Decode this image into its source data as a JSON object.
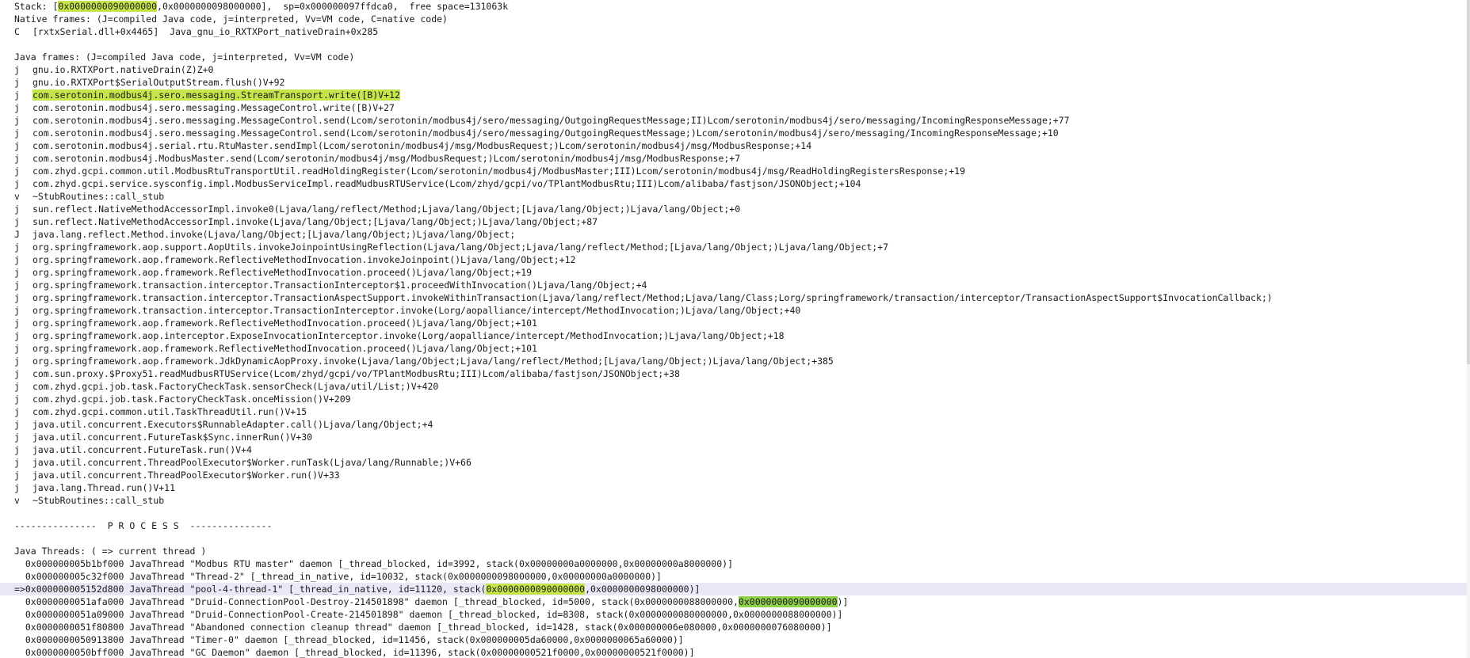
{
  "editor": {
    "stack_line": {
      "prefix": "Stack: [",
      "hl": "0x0000000090000000",
      "suffix": ",0x0000000098000000],  sp=0x000000097ffdca0,  free space=131063k"
    },
    "native_header": "Native frames: (J=compiled Java code, j=interpreted, Vv=VM code, C=native code)",
    "native_frame": {
      "type": "C",
      "text": "[rxtxSerial.dll+0x4465]  Java_gnu_io_RXTXPort_nativeDrain+0x285"
    },
    "java_header": "Java frames: (J=compiled Java code, j=interpreted, Vv=VM code)",
    "java_frames": [
      {
        "type": "j",
        "text": "gnu.io.RXTXPort.nativeDrain(Z)Z+0"
      },
      {
        "type": "j",
        "text": "gnu.io.RXTXPort$SerialOutputStream.flush()V+92"
      },
      {
        "type": "j",
        "text": "com.serotonin.modbus4j.sero.messaging.StreamTransport.write([B)V+12"
      },
      {
        "type": "j",
        "text": "com.serotonin.modbus4j.sero.messaging.MessageControl.write([B)V+27"
      },
      {
        "type": "j",
        "text": "com.serotonin.modbus4j.sero.messaging.MessageControl.send(Lcom/serotonin/modbus4j/sero/messaging/OutgoingRequestMessage;II)Lcom/serotonin/modbus4j/sero/messaging/IncomingResponseMessage;+77"
      },
      {
        "type": "j",
        "text": "com.serotonin.modbus4j.sero.messaging.MessageControl.send(Lcom/serotonin/modbus4j/sero/messaging/OutgoingRequestMessage;)Lcom/serotonin/modbus4j/sero/messaging/IncomingResponseMessage;+10"
      },
      {
        "type": "j",
        "text": "com.serotonin.modbus4j.serial.rtu.RtuMaster.sendImpl(Lcom/serotonin/modbus4j/msg/ModbusRequest;)Lcom/serotonin/modbus4j/msg/ModbusResponse;+14"
      },
      {
        "type": "j",
        "text": "com.serotonin.modbus4j.ModbusMaster.send(Lcom/serotonin/modbus4j/msg/ModbusRequest;)Lcom/serotonin/modbus4j/msg/ModbusResponse;+7"
      },
      {
        "type": "j",
        "text": "com.zhyd.gcpi.common.util.ModbusRtuTransportUtil.readHoldingRegister(Lcom/serotonin/modbus4j/ModbusMaster;III)Lcom/serotonin/modbus4j/msg/ReadHoldingRegistersResponse;+19"
      },
      {
        "type": "j",
        "text": "com.zhyd.gcpi.service.sysconfig.impl.ModbusServiceImpl.readMudbusRTUService(Lcom/zhyd/gcpi/vo/TPlantModbusRtu;III)Lcom/alibaba/fastjson/JSONObject;+104"
      },
      {
        "type": "v",
        "text": "~StubRoutines::call_stub"
      },
      {
        "type": "j",
        "text": "sun.reflect.NativeMethodAccessorImpl.invoke0(Ljava/lang/reflect/Method;Ljava/lang/Object;[Ljava/lang/Object;)Ljava/lang/Object;+0"
      },
      {
        "type": "j",
        "text": "sun.reflect.NativeMethodAccessorImpl.invoke(Ljava/lang/Object;[Ljava/lang/Object;)Ljava/lang/Object;+87"
      },
      {
        "type": "J",
        "text": "java.lang.reflect.Method.invoke(Ljava/lang/Object;[Ljava/lang/Object;)Ljava/lang/Object;"
      },
      {
        "type": "j",
        "text": "org.springframework.aop.support.AopUtils.invokeJoinpointUsingReflection(Ljava/lang/Object;Ljava/lang/reflect/Method;[Ljava/lang/Object;)Ljava/lang/Object;+7"
      },
      {
        "type": "j",
        "text": "org.springframework.aop.framework.ReflectiveMethodInvocation.invokeJoinpoint()Ljava/lang/Object;+12"
      },
      {
        "type": "j",
        "text": "org.springframework.aop.framework.ReflectiveMethodInvocation.proceed()Ljava/lang/Object;+19"
      },
      {
        "type": "j",
        "text": "org.springframework.transaction.interceptor.TransactionInterceptor$1.proceedWithInvocation()Ljava/lang/Object;+4"
      },
      {
        "type": "j",
        "text": "org.springframework.transaction.interceptor.TransactionAspectSupport.invokeWithinTransaction(Ljava/lang/reflect/Method;Ljava/lang/Class;Lorg/springframework/transaction/interceptor/TransactionAspectSupport$InvocationCallback;)"
      },
      {
        "type": "j",
        "text": "org.springframework.transaction.interceptor.TransactionInterceptor.invoke(Lorg/aopalliance/intercept/MethodInvocation;)Ljava/lang/Object;+40"
      },
      {
        "type": "j",
        "text": "org.springframework.aop.framework.ReflectiveMethodInvocation.proceed()Ljava/lang/Object;+101"
      },
      {
        "type": "j",
        "text": "org.springframework.aop.interceptor.ExposeInvocationInterceptor.invoke(Lorg/aopalliance/intercept/MethodInvocation;)Ljava/lang/Object;+18"
      },
      {
        "type": "j",
        "text": "org.springframework.aop.framework.ReflectiveMethodInvocation.proceed()Ljava/lang/Object;+101"
      },
      {
        "type": "j",
        "text": "org.springframework.aop.framework.JdkDynamicAopProxy.invoke(Ljava/lang/Object;Ljava/lang/reflect/Method;[Ljava/lang/Object;)Ljava/lang/Object;+385"
      },
      {
        "type": "j",
        "text": "com.sun.proxy.$Proxy51.readMudbusRTUService(Lcom/zhyd/gcpi/vo/TPlantModbusRtu;III)Lcom/alibaba/fastjson/JSONObject;+38"
      },
      {
        "type": "j",
        "text": "com.zhyd.gcpi.job.task.FactoryCheckTask.sensorCheck(Ljava/util/List;)V+420"
      },
      {
        "type": "j",
        "text": "com.zhyd.gcpi.job.task.FactoryCheckTask.onceMission()V+209"
      },
      {
        "type": "j",
        "text": "com.zhyd.gcpi.common.util.TaskThreadUtil.run()V+15"
      },
      {
        "type": "j",
        "text": "java.util.concurrent.Executors$RunnableAdapter.call()Ljava/lang/Object;+4"
      },
      {
        "type": "j",
        "text": "java.util.concurrent.FutureTask$Sync.innerRun()V+30"
      },
      {
        "type": "j",
        "text": "java.util.concurrent.FutureTask.run()V+4"
      },
      {
        "type": "j",
        "text": "java.util.concurrent.ThreadPoolExecutor$Worker.runTask(Ljava/lang/Runnable;)V+66"
      },
      {
        "type": "j",
        "text": "java.util.concurrent.ThreadPoolExecutor$Worker.run()V+33"
      },
      {
        "type": "j",
        "text": "java.lang.Thread.run()V+11"
      },
      {
        "type": "v",
        "text": "~StubRoutines::call_stub"
      }
    ],
    "process_header": "---------------  P R O C E S S  ---------------",
    "threads_header": "Java Threads: ( => current thread )",
    "threads": [
      {
        "text": "  0x000000005b1bf000 JavaThread \"Modbus RTU master\" daemon [_thread_blocked, id=3992, stack(0x00000000a0000000,0x00000000a8000000)]"
      },
      {
        "text": "  0x000000005c32f000 JavaThread \"Thread-2\" [_thread_in_native, id=10032, stack(0x0000000098000000,0x00000000a0000000)]"
      },
      {
        "prefix": "=>0x000000005152d800 JavaThread \"pool-4-thread-1\" [_thread_in_native, id=11120, stack(",
        "hl": "0x0000000090000000",
        "suffix": ",0x0000000098000000)]",
        "current": true
      },
      {
        "prefix": "  0x0000000051afa000 JavaThread \"Druid-ConnectionPool-Destroy-214501898\" daemon [_thread_blocked, id=5000, stack(0x0000000088000000,",
        "hl": "0x0000000090000000",
        "suffix": ")]",
        "green": true
      },
      {
        "text": "  0x0000000051a09000 JavaThread \"Druid-ConnectionPool-Create-214501898\" daemon [_thread_blocked, id=8308, stack(0x0000000080000000,0x0000000088000000)]"
      },
      {
        "text": "  0x0000000051f80800 JavaThread \"Abandoned connection cleanup thread\" daemon [_thread_blocked, id=1428, stack(0x000000006e080000,0x0000000076080000)]"
      },
      {
        "text": "  0x0000000050913800 JavaThread \"Timer-0\" daemon [_thread_blocked, id=11456, stack(0x000000005da60000,0x0000000065a60000)]"
      },
      {
        "text": "  0x0000000050bff000 JavaThread \"GC Daemon\" daemon [_thread_blocked, id=11396, stack(0x00000000521f0000,0x00000000521f0000)]"
      }
    ]
  }
}
